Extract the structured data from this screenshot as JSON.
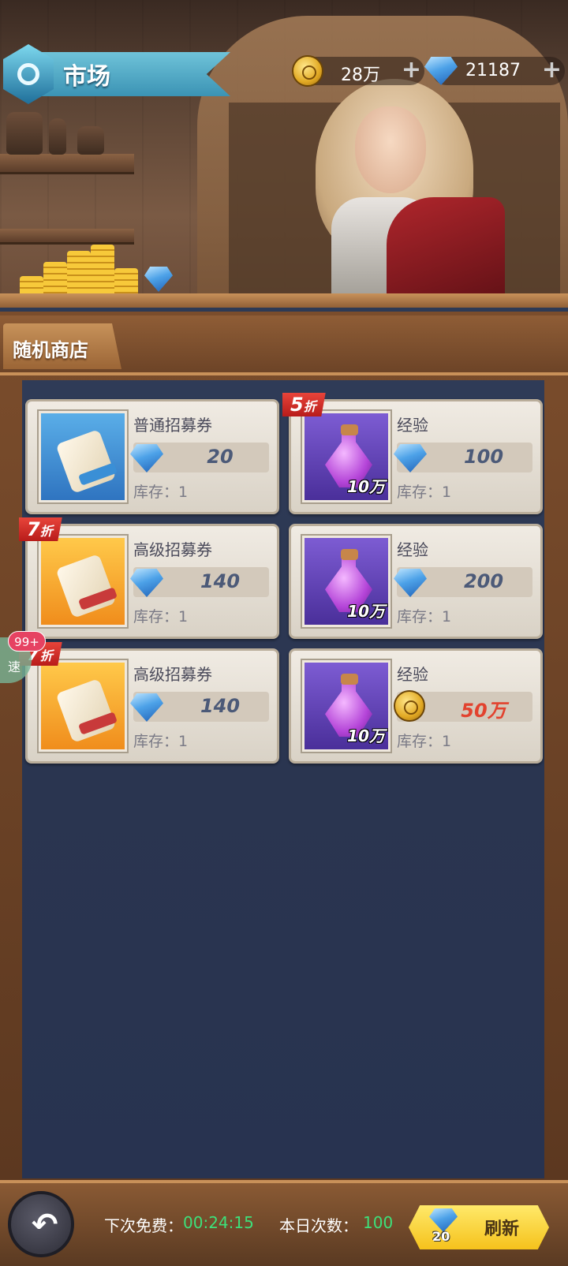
{
  "header": {
    "title": "市场",
    "coins": "28万",
    "gems": "21187"
  },
  "tab": {
    "label": "随机商店"
  },
  "items": [
    {
      "name": "普通招募券",
      "price": "20",
      "currency": "gem",
      "stock_label": "库存：",
      "stock": "1",
      "discount": "",
      "discount_suffix": "",
      "qty": "",
      "icon": "scroll-blue-icon"
    },
    {
      "name": "经验",
      "price": "100",
      "currency": "gem",
      "stock_label": "库存：",
      "stock": "1",
      "discount": "5",
      "discount_suffix": "折",
      "qty": "10万",
      "icon": "potion-icon"
    },
    {
      "name": "高级招募券",
      "price": "140",
      "currency": "gem",
      "stock_label": "库存：",
      "stock": "1",
      "discount": "7",
      "discount_suffix": "折",
      "qty": "",
      "icon": "scroll-gold-icon"
    },
    {
      "name": "经验",
      "price": "200",
      "currency": "gem",
      "stock_label": "库存：",
      "stock": "1",
      "discount": "",
      "discount_suffix": "",
      "qty": "10万",
      "icon": "potion-icon"
    },
    {
      "name": "高级招募券",
      "price": "140",
      "currency": "gem",
      "stock_label": "库存：",
      "stock": "1",
      "discount": "7",
      "discount_suffix": "折",
      "qty": "",
      "icon": "scroll-gold-icon"
    },
    {
      "name": "经验",
      "price": "50万",
      "currency": "coin",
      "stock_label": "库存：",
      "stock": "1",
      "discount": "",
      "discount_suffix": "",
      "qty": "10万",
      "icon": "potion-icon"
    }
  ],
  "side": {
    "badge": "99+",
    "label": "速"
  },
  "footer": {
    "next_free_label": "下次免费：",
    "next_free_time": "00:24:15",
    "daily_label": "本日次数：",
    "daily_count": "100",
    "refresh_cost": "20",
    "refresh_label": "刷新"
  },
  "colors": {
    "panel_bg": "#2d3a55",
    "price_text": "#4c5a78",
    "price_red": "#e2422e",
    "timer_green": "#3de07a",
    "discount_red": "#d62c26"
  }
}
